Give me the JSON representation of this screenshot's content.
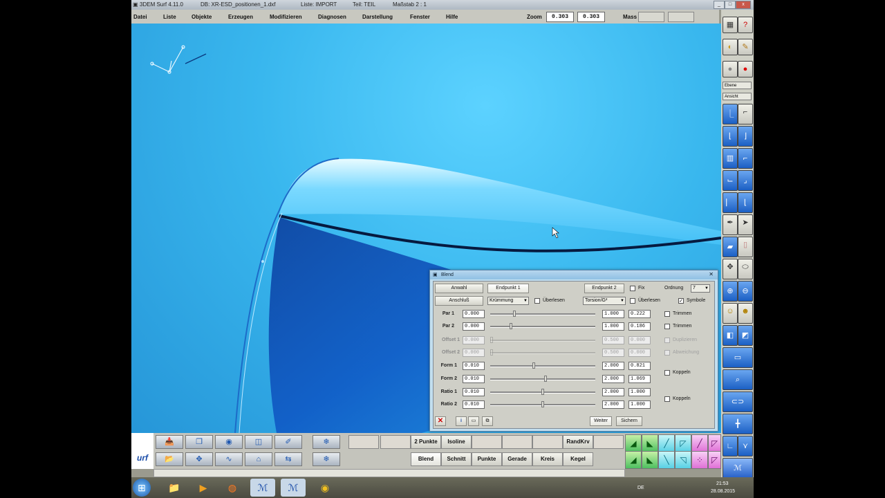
{
  "window": {
    "title_app": "3DEM Surf 4.11.0",
    "title_file": "DB: XR-ESD_positionen_1.dxf",
    "title_list": "Liste: IMPORT",
    "title_part": "Teil: TEIL",
    "title_scale": "Maßstab 2 : 1",
    "btn_min": "_",
    "btn_max": "□",
    "btn_close": "x"
  },
  "menu": {
    "items": [
      "Datei",
      "Liste",
      "Objekte",
      "Erzeugen",
      "Modifizieren",
      "Diagnosen",
      "Darstellung",
      "Fenster",
      "Hilfe"
    ],
    "zoom_label": "Zoom",
    "zoom_value1": "0.303",
    "zoom_value2": "0.303",
    "mass_label": "Mass"
  },
  "righttb": {
    "select1": "Ebene",
    "select2": "Ansicht"
  },
  "bottom": {
    "row1_buttons": [
      "2 Punkte",
      "Isoline",
      "",
      "",
      "",
      "RandKrv",
      ""
    ],
    "row2_buttons": [
      "Blend",
      "Schnitt",
      "Punkte",
      "Gerade",
      "Kreis",
      "Kegel"
    ],
    "logo_text": "urf"
  },
  "dialog": {
    "title": "Blend",
    "btn_anwahl": "Anwahl",
    "btn_endpunkt1": "Endpunkt 1",
    "btn_endpunkt2": "Endpunkt 2",
    "chk_fix": "Fix",
    "ordnung_label": "Ordnung",
    "ordnung_value": "7",
    "btn_anschluss": "Anschluß",
    "combo_kruemmung": "Krümmung",
    "chk_ueberlesen1": "Überlesen",
    "combo_torsion": "Torsion/G²",
    "chk_ueberlesen2": "Überlesen",
    "chk_symbole": "Symbole",
    "check_mark": "✓",
    "rows": [
      {
        "label": "Par 1",
        "val": "0.000",
        "min": "1.000",
        "cur": "0.222",
        "enabled": true
      },
      {
        "label": "Par 2",
        "val": "0.000",
        "min": "1.000",
        "cur": "0.186",
        "enabled": true
      },
      {
        "label": "Offset 1",
        "val": "0.000",
        "min": "0.500",
        "cur": "0.000",
        "enabled": false
      },
      {
        "label": "Offset 2",
        "val": "0.000",
        "min": "0.500",
        "cur": "0.000",
        "enabled": false
      },
      {
        "label": "Form 1",
        "val": "0.010",
        "min": "2.000",
        "cur": "0.821",
        "enabled": true
      },
      {
        "label": "Form 2",
        "val": "0.010",
        "min": "2.000",
        "cur": "1.069",
        "enabled": true
      },
      {
        "label": "Ratio 1",
        "val": "0.010",
        "min": "2.000",
        "cur": "1.000",
        "enabled": true
      },
      {
        "label": "Ratio 2",
        "val": "0.010",
        "min": "2.000",
        "cur": "1.000",
        "enabled": true
      }
    ],
    "slider_pos": [
      0.22,
      0.19,
      0.0,
      0.0,
      0.41,
      0.53,
      0.5,
      0.5
    ],
    "chk_trimmen1": "Trimmen",
    "chk_trimmen2": "Trimmen",
    "chk_duplizieren": "Duplizieren",
    "chk_abweichung": "Abweichung",
    "chk_koppeln1": "Koppeln",
    "chk_koppeln2": "Koppeln",
    "btn_weiter": "Weiter",
    "btn_sichern": "Sichern"
  },
  "taskbar": {
    "lang": "DE",
    "time": "21:53",
    "date": "28.08.2015"
  }
}
